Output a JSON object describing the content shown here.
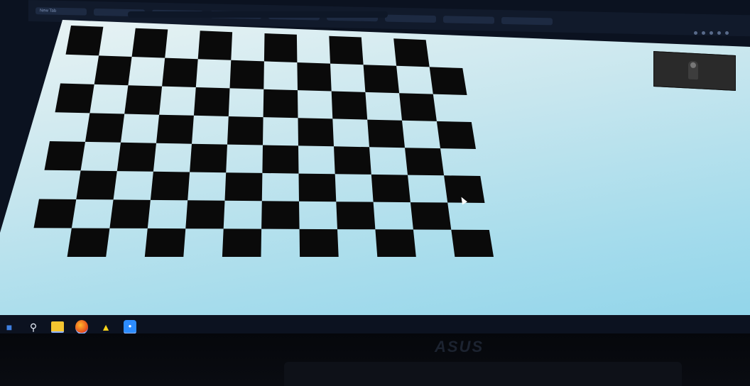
{
  "browser": {
    "tabs": [
      "New Tab",
      "",
      "",
      "",
      "",
      "",
      "",
      "",
      ""
    ],
    "address": ""
  },
  "page": {
    "content": "checkerboard calibration pattern",
    "board_rows": 8,
    "board_cols": 12
  },
  "video_tile": {
    "icon": "participant-video"
  },
  "taskbar": {
    "icons": [
      "windows-start-icon",
      "search-icon",
      "file-explorer-icon",
      "firefox-icon",
      "app-icon",
      "zoom-icon"
    ]
  },
  "monitor": {
    "brand": "ASUS"
  },
  "colors": {
    "square": "#0a0a0a",
    "page": "#c7e6ee",
    "taskbar": "#0c1220"
  }
}
